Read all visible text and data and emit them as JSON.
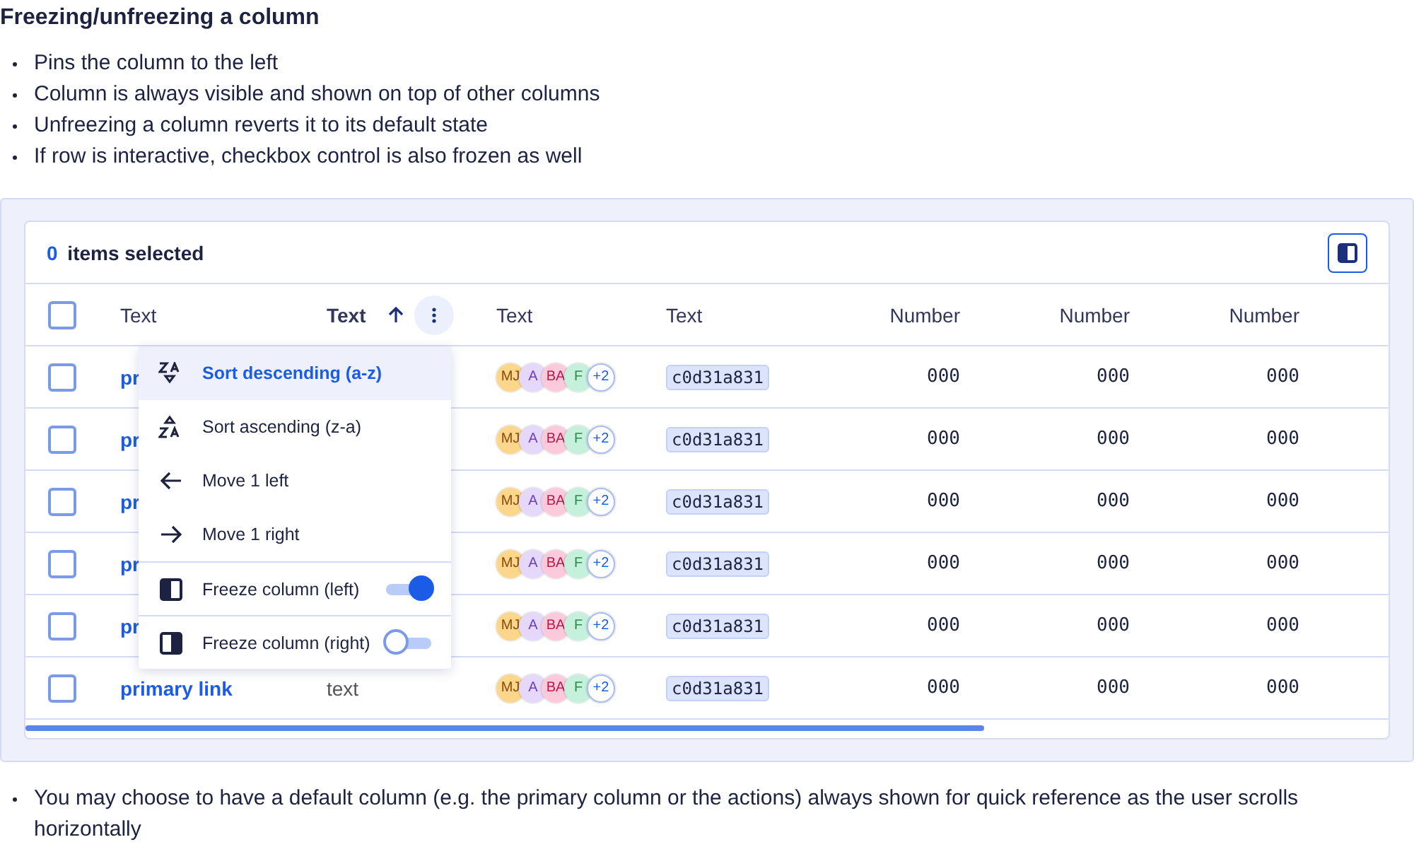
{
  "title": "Freezing/unfreezing a column",
  "bullets": [
    "Pins the column to the left",
    "Column is always visible and shown on top of other columns",
    "Unfreezing a column reverts it to its default state",
    "If row is interactive, checkbox control is also frozen as well"
  ],
  "table": {
    "selected_count": "0",
    "selected_label": "items selected",
    "all_checked": false,
    "columns": [
      {
        "label": "Text",
        "sorted": false
      },
      {
        "label": "Text",
        "sorted": true
      },
      {
        "label": "Text",
        "sorted": false
      },
      {
        "label": "Text",
        "sorted": false
      },
      {
        "label": "Number",
        "sorted": false
      },
      {
        "label": "Number",
        "sorted": false
      },
      {
        "label": "Number",
        "sorted": false
      }
    ],
    "rows": [
      {
        "checked": false,
        "link": "pr",
        "avatars": [
          {
            "initials": "MJ",
            "color": "#fcd68a"
          },
          {
            "initials": "A",
            "color": "#e5d8fb"
          },
          {
            "initials": "BA",
            "color": "#fccadb"
          },
          {
            "initials": "F",
            "color": "#c5f1dc"
          }
        ],
        "more": "+2",
        "hash": "c0d31a831",
        "numbers": [
          "000",
          "000",
          "000"
        ]
      },
      {
        "checked": false,
        "link": "pr",
        "avatars": [
          {
            "initials": "MJ",
            "color": "#fcd68a"
          },
          {
            "initials": "A",
            "color": "#e5d8fb"
          },
          {
            "initials": "BA",
            "color": "#fccadb"
          },
          {
            "initials": "F",
            "color": "#c5f1dc"
          }
        ],
        "more": "+2",
        "hash": "c0d31a831",
        "numbers": [
          "000",
          "000",
          "000"
        ]
      },
      {
        "checked": false,
        "link": "pr",
        "avatars": [
          {
            "initials": "MJ",
            "color": "#fcd68a"
          },
          {
            "initials": "A",
            "color": "#e5d8fb"
          },
          {
            "initials": "BA",
            "color": "#fccadb"
          },
          {
            "initials": "F",
            "color": "#c5f1dc"
          }
        ],
        "more": "+2",
        "hash": "c0d31a831",
        "numbers": [
          "000",
          "000",
          "000"
        ]
      },
      {
        "checked": false,
        "link": "pr",
        "avatars": [
          {
            "initials": "MJ",
            "color": "#fcd68a"
          },
          {
            "initials": "A",
            "color": "#e5d8fb"
          },
          {
            "initials": "BA",
            "color": "#fccadb"
          },
          {
            "initials": "F",
            "color": "#c5f1dc"
          }
        ],
        "more": "+2",
        "hash": "c0d31a831",
        "numbers": [
          "000",
          "000",
          "000"
        ]
      },
      {
        "checked": false,
        "link": "pr",
        "avatars": [
          {
            "initials": "MJ",
            "color": "#fcd68a"
          },
          {
            "initials": "A",
            "color": "#e5d8fb"
          },
          {
            "initials": "BA",
            "color": "#fccadb"
          },
          {
            "initials": "F",
            "color": "#c5f1dc"
          }
        ],
        "more": "+2",
        "hash": "c0d31a831",
        "numbers": [
          "000",
          "000",
          "000"
        ]
      },
      {
        "checked": false,
        "link": "primary link",
        "text": "text",
        "avatars": [
          {
            "initials": "MJ",
            "color": "#fcd68a"
          },
          {
            "initials": "A",
            "color": "#e5d8fb"
          },
          {
            "initials": "BA",
            "color": "#fccadb"
          },
          {
            "initials": "F",
            "color": "#c5f1dc"
          }
        ],
        "more": "+2",
        "hash": "c0d31a831",
        "numbers": [
          "000",
          "000",
          "000"
        ]
      }
    ]
  },
  "column_menu": {
    "items": [
      {
        "kind": "action",
        "label": "Sort descending (a-z)",
        "selected": true
      },
      {
        "kind": "action",
        "label": "Sort ascending (z-a)",
        "selected": false
      },
      {
        "kind": "action",
        "label": "Move 1 left",
        "selected": false
      },
      {
        "kind": "action",
        "label": "Move 1 right",
        "selected": false
      },
      {
        "kind": "toggle",
        "label": "Freeze column (left)",
        "selected": false,
        "on": true
      },
      {
        "kind": "toggle",
        "label": "Freeze column (right)",
        "selected": false,
        "on": false
      }
    ]
  },
  "footer_bullets": [
    "You may choose to have a default column (e.g. the primary column or the actions) always shown for quick reference as the user scrolls horizontally"
  ]
}
